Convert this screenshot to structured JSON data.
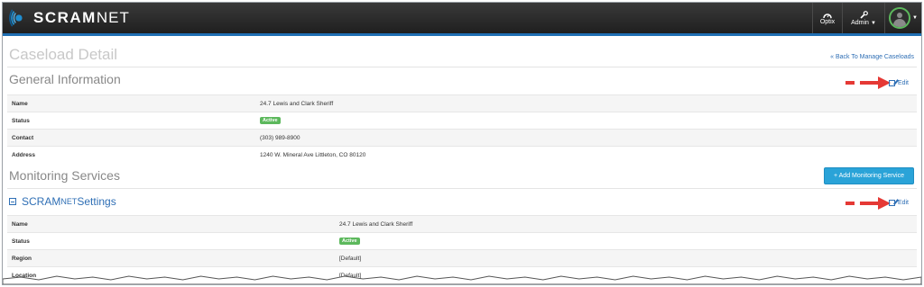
{
  "navbar": {
    "logo_main": "SCRAM",
    "logo_suffix": "NET",
    "optix_label": "Optix",
    "admin_label": "Admin"
  },
  "page": {
    "title": "Caseload Detail",
    "back_link": "« Back To Manage Caseloads"
  },
  "general": {
    "title": "General Information",
    "edit_label": "Edit",
    "rows": [
      {
        "label": "Name",
        "value": "24.7 Lewis and Clark Sheriff"
      },
      {
        "label": "Status",
        "value": "Active"
      },
      {
        "label": "Contact",
        "value": "(303) 989-8900"
      },
      {
        "label": "Address",
        "value": "1240 W. Mineral Ave Littleton, CO 80120"
      }
    ]
  },
  "monitoring": {
    "title": "Monitoring Services",
    "add_button": "+ Add Monitoring Service",
    "section_prefix": "SCRAM",
    "section_suffix": "NET",
    "section_title": " Settings",
    "edit_label": "Edit",
    "rows": [
      {
        "label": "Name",
        "value": "24.7 Lewis and Clark Sheriff"
      },
      {
        "label": "Status",
        "value": "Active"
      },
      {
        "label": "Region",
        "value": "[Default]"
      },
      {
        "label": "Location",
        "value": "[Default]"
      }
    ]
  },
  "colors": {
    "navbar": "#2a2a2a",
    "accent": "#2f6fb5",
    "active_badge": "#5cb85c",
    "add_button": "#2aa3d8",
    "annotation_arrow": "#e53935"
  }
}
